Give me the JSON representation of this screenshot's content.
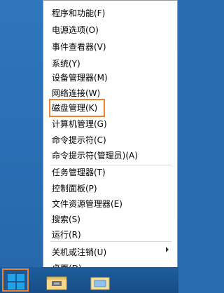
{
  "menu": {
    "items": [
      {
        "label": "程序和功能(F)"
      },
      {
        "label": "电源选项(O)"
      },
      {
        "label": "事件查看器(V)"
      },
      {
        "label": "系统(Y)"
      },
      {
        "label": "设备管理器(M)"
      },
      {
        "label": "网络连接(W)"
      },
      {
        "label": "磁盘管理(K)"
      },
      {
        "label": "计算机管理(G)"
      },
      {
        "label": "命令提示符(C)"
      },
      {
        "label": "命令提示符(管理员)(A)"
      },
      {
        "label": "任务管理器(T)"
      },
      {
        "label": "控制面板(P)"
      },
      {
        "label": "文件资源管理器(E)"
      },
      {
        "label": "搜索(S)"
      },
      {
        "label": "运行(R)"
      },
      {
        "label": "关机或注销(U)"
      },
      {
        "label": "桌面(D)"
      }
    ]
  },
  "icons": {
    "start": "windows-start-icon",
    "explorer": "file-explorer-icon",
    "taskbar_app": "taskbar-app-icon",
    "submenu": "chevron-right-icon"
  },
  "colors": {
    "highlight": "#f0802a",
    "taskbar": "#1c5d9c",
    "win_logo": "#1fa3e6"
  }
}
